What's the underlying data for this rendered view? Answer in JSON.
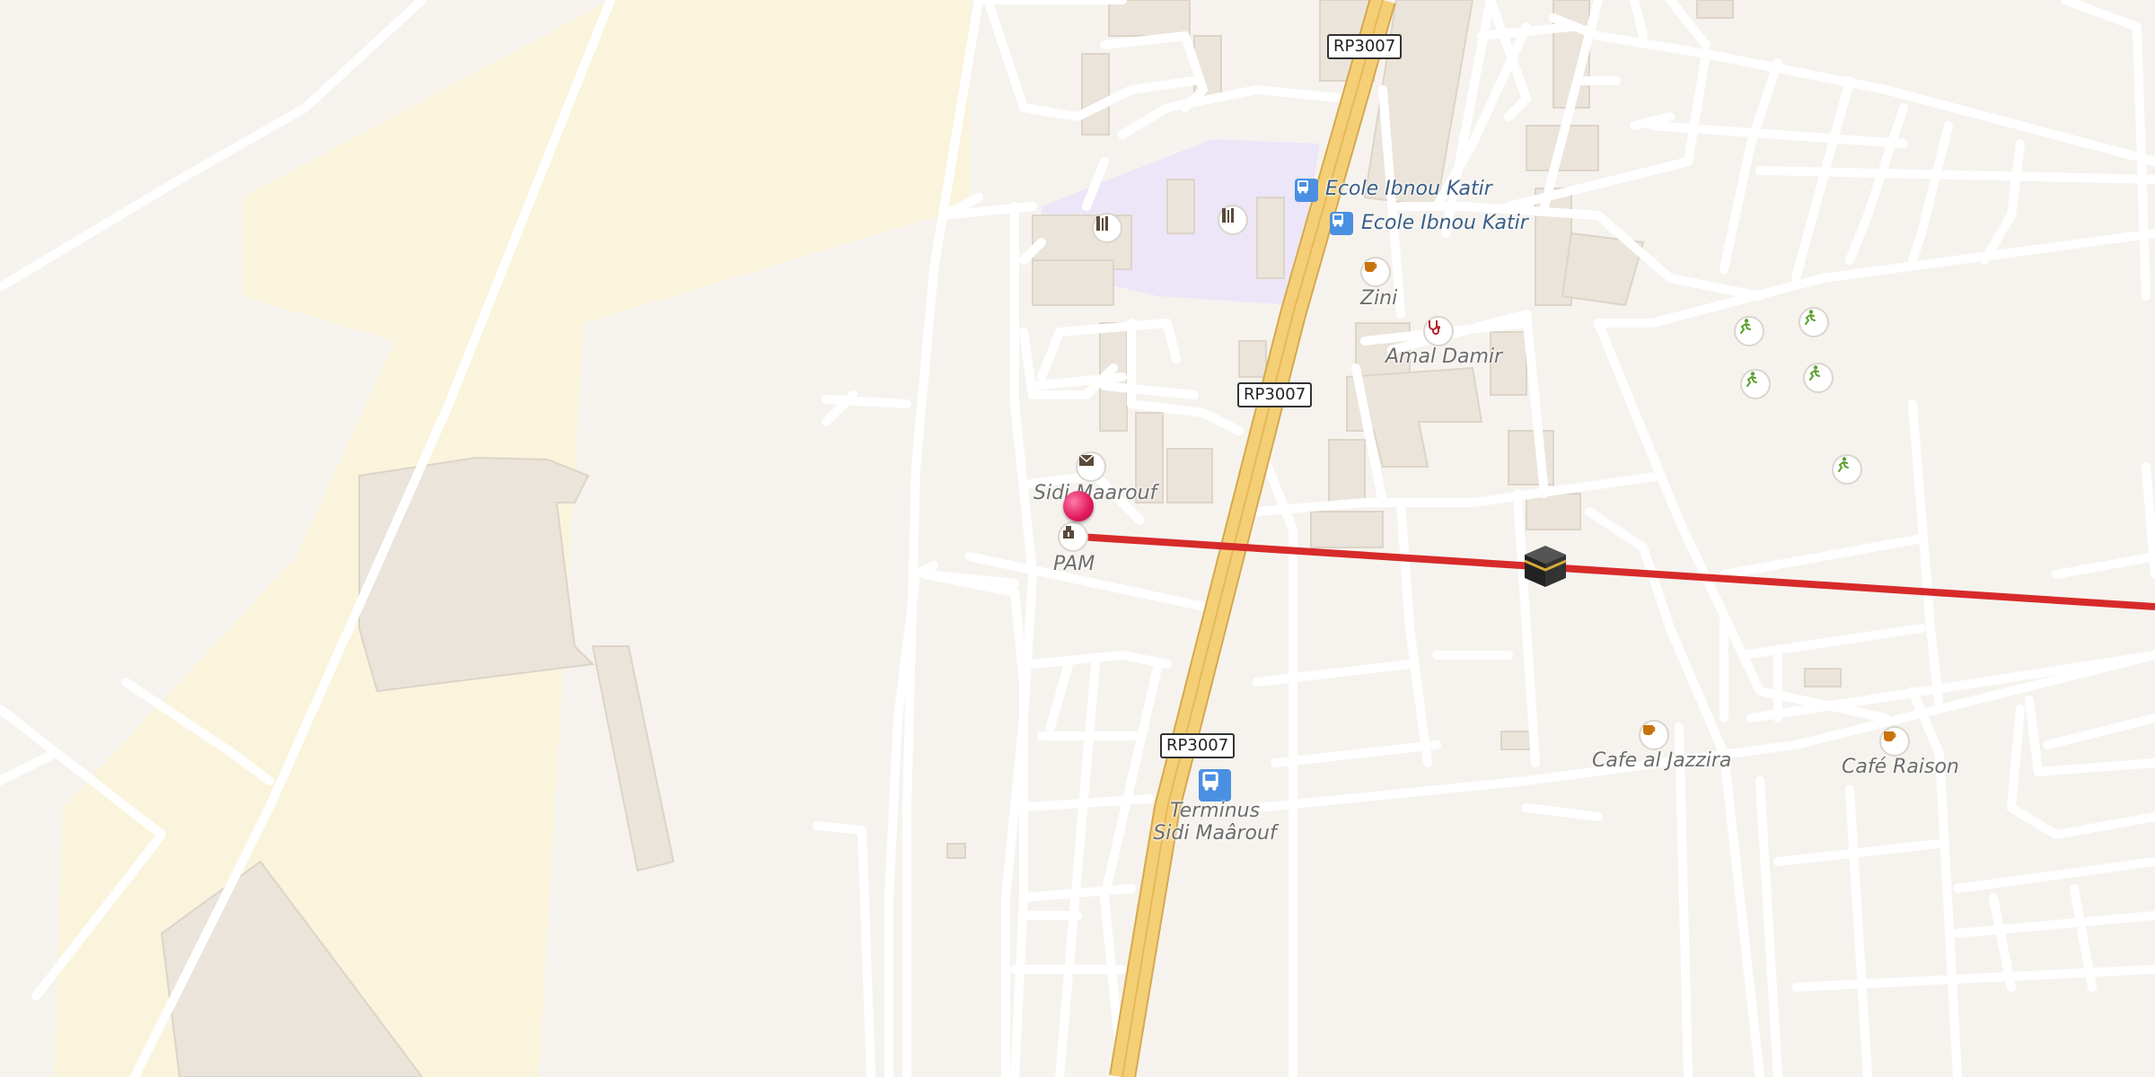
{
  "road_shields": [
    "RP3007",
    "RP3007",
    "RP3007"
  ],
  "places": {
    "ecole_1": "Ecole Ibnou Katir",
    "ecole_2": "Ecole Ibnou Katir",
    "zini": "Zini",
    "amal_damir": "Amal Damir",
    "sidi_maarouf": "Sidi Maarouf",
    "pam": "PAM",
    "terminus_line1": "Terminus",
    "terminus_line2": "Sidi Maârouf",
    "cafe_jazzira": "Cafe al Jazzira",
    "cafe_raison": "Café Raison"
  },
  "icons": {
    "school": "school-icon",
    "bus": "bus-stop-icon",
    "cafe": "cafe-icon",
    "doctor": "stethoscope-icon",
    "post": "envelope-icon",
    "atm": "atm-icon",
    "sport": "running-person-icon",
    "pin": "location-pin",
    "destination": "kaaba-icon"
  },
  "colors": {
    "background": "#f6f3ee",
    "industrial": "#fbf4dc",
    "school_area": "#ece6f8",
    "building": "#ebe4da",
    "road": "#ffffff",
    "highway": "#f5cf76",
    "qibla_line": "#d72a2a",
    "pin": "#e0185c",
    "bus": "#4a90e2",
    "cafe": "#c8720a",
    "sport": "#5aa02c"
  }
}
